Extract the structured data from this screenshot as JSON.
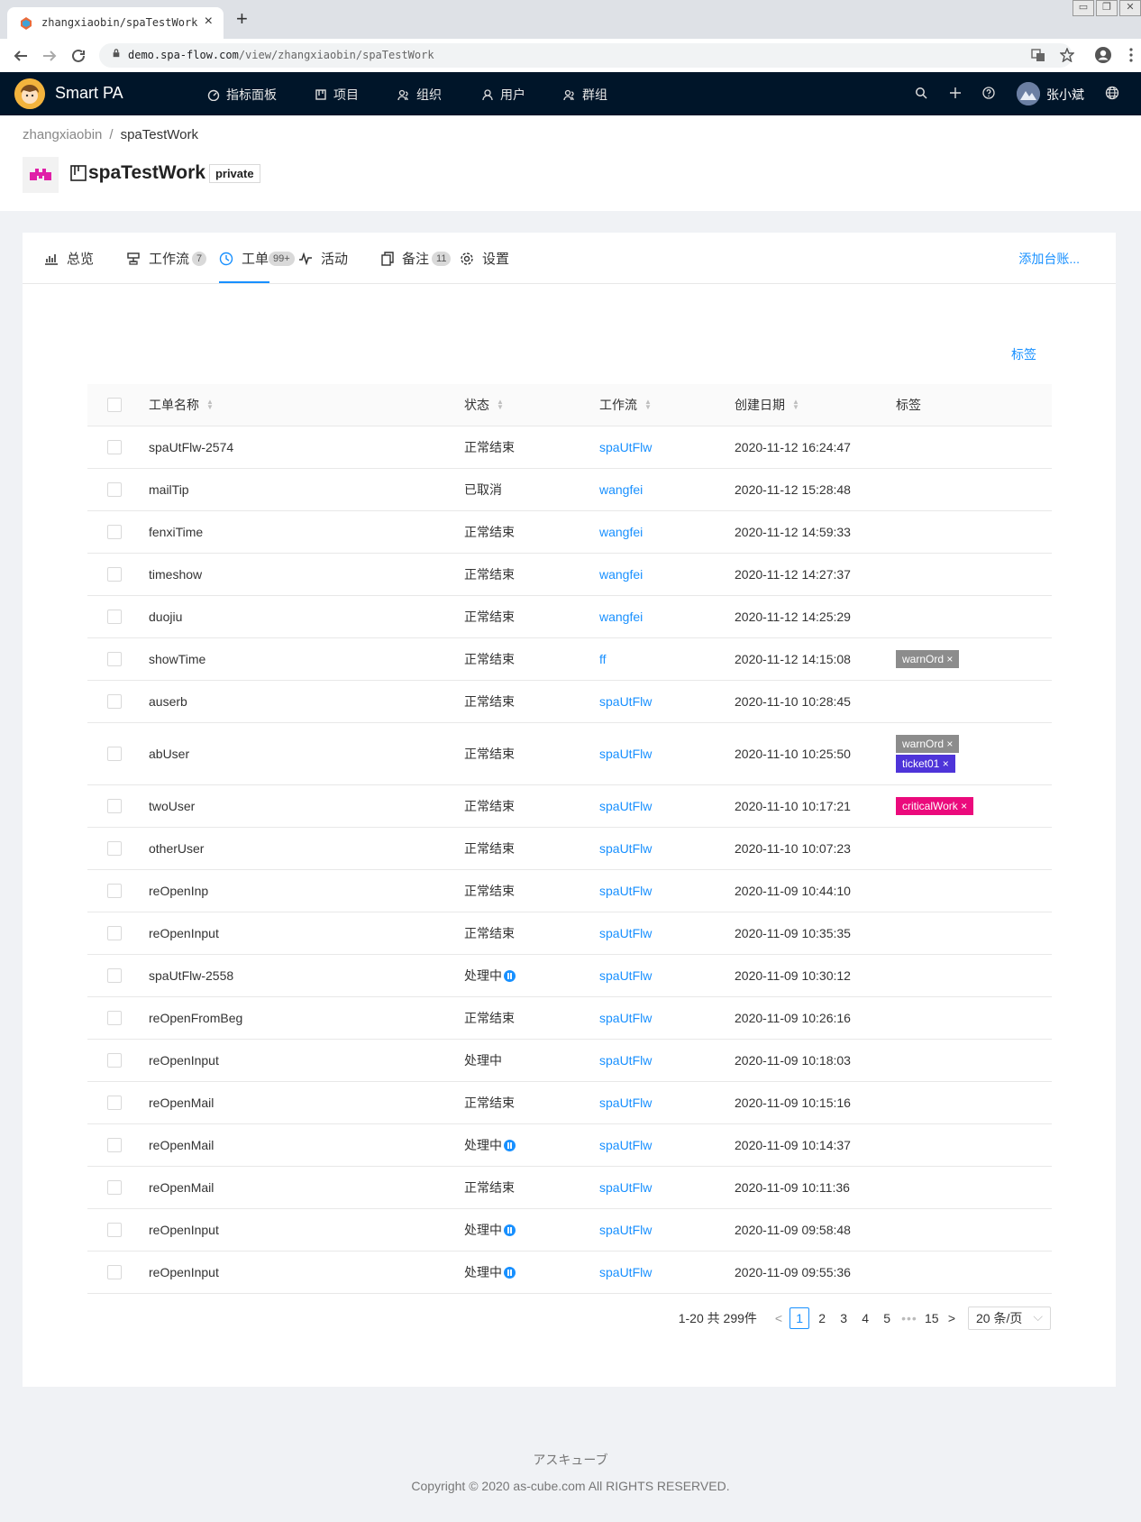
{
  "browser": {
    "tab_title": "zhangxiaobin/spaTestWork",
    "tab_close": "×",
    "new_tab": "+",
    "url_host": "demo.spa-flow.com",
    "url_path": "/view/zhangxiaobin/spaTestWork"
  },
  "header": {
    "brand": "Smart PA",
    "menu": [
      "指标面板",
      "项目",
      "组织",
      "用户",
      "群组"
    ],
    "user_name": "张小斌"
  },
  "breadcrumb": {
    "parent": "zhangxiaobin",
    "separator": "/",
    "current": "spaTestWork"
  },
  "project": {
    "title": "spaTestWork",
    "visibility": "private"
  },
  "tabs": [
    {
      "label": "总览",
      "badge": ""
    },
    {
      "label": "工作流",
      "badge": "7"
    },
    {
      "label": "工单",
      "badge": "99+"
    },
    {
      "label": "活动",
      "badge": ""
    },
    {
      "label": "备注",
      "badge": "11"
    },
    {
      "label": "设置",
      "badge": ""
    }
  ],
  "add_ledger": "添加台账...",
  "tag_link": "标签",
  "table": {
    "columns": [
      "工单名称",
      "状态",
      "工作流",
      "创建日期",
      "标签"
    ],
    "rows": [
      {
        "name": "spaUtFlw-2574",
        "status": "正常结束",
        "paused": false,
        "flow": "spaUtFlw",
        "date": "2020-11-12 16:24:47",
        "tags": []
      },
      {
        "name": "mailTip",
        "status": "已取消",
        "paused": false,
        "flow": "wangfei",
        "date": "2020-11-12 15:28:48",
        "tags": []
      },
      {
        "name": "fenxiTime",
        "status": "正常结束",
        "paused": false,
        "flow": "wangfei",
        "date": "2020-11-12 14:59:33",
        "tags": []
      },
      {
        "name": "timeshow",
        "status": "正常结束",
        "paused": false,
        "flow": "wangfei",
        "date": "2020-11-12 14:27:37",
        "tags": []
      },
      {
        "name": "duojiu",
        "status": "正常结束",
        "paused": false,
        "flow": "wangfei",
        "date": "2020-11-12 14:25:29",
        "tags": []
      },
      {
        "name": "showTime",
        "status": "正常结束",
        "paused": false,
        "flow": "ff",
        "date": "2020-11-12 14:15:08",
        "tags": [
          {
            "label": "warnOrd ×",
            "color": "#8c8c8c"
          }
        ]
      },
      {
        "name": "auserb",
        "status": "正常结束",
        "paused": false,
        "flow": "spaUtFlw",
        "date": "2020-11-10 10:28:45",
        "tags": []
      },
      {
        "name": "abUser",
        "status": "正常结束",
        "paused": false,
        "flow": "spaUtFlw",
        "date": "2020-11-10 10:25:50",
        "tags": [
          {
            "label": "warnOrd ×",
            "color": "#8c8c8c"
          },
          {
            "label": "ticket01 ×",
            "color": "#4e34d9"
          }
        ]
      },
      {
        "name": "twoUser",
        "status": "正常结束",
        "paused": false,
        "flow": "spaUtFlw",
        "date": "2020-11-10 10:17:21",
        "tags": [
          {
            "label": "criticalWork ×",
            "color": "#eb0a7c"
          }
        ]
      },
      {
        "name": "otherUser",
        "status": "正常结束",
        "paused": false,
        "flow": "spaUtFlw",
        "date": "2020-11-10 10:07:23",
        "tags": []
      },
      {
        "name": "reOpenInp",
        "status": "正常结束",
        "paused": false,
        "flow": "spaUtFlw",
        "date": "2020-11-09 10:44:10",
        "tags": []
      },
      {
        "name": "reOpenInput",
        "status": "正常结束",
        "paused": false,
        "flow": "spaUtFlw",
        "date": "2020-11-09 10:35:35",
        "tags": []
      },
      {
        "name": "spaUtFlw-2558",
        "status": "处理中",
        "paused": true,
        "flow": "spaUtFlw",
        "date": "2020-11-09 10:30:12",
        "tags": []
      },
      {
        "name": "reOpenFromBeg",
        "status": "正常结束",
        "paused": false,
        "flow": "spaUtFlw",
        "date": "2020-11-09 10:26:16",
        "tags": []
      },
      {
        "name": "reOpenInput",
        "status": "处理中",
        "paused": false,
        "flow": "spaUtFlw",
        "date": "2020-11-09 10:18:03",
        "tags": []
      },
      {
        "name": "reOpenMail",
        "status": "正常结束",
        "paused": false,
        "flow": "spaUtFlw",
        "date": "2020-11-09 10:15:16",
        "tags": []
      },
      {
        "name": "reOpenMail",
        "status": "处理中",
        "paused": true,
        "flow": "spaUtFlw",
        "date": "2020-11-09 10:14:37",
        "tags": []
      },
      {
        "name": "reOpenMail",
        "status": "正常结束",
        "paused": false,
        "flow": "spaUtFlw",
        "date": "2020-11-09 10:11:36",
        "tags": []
      },
      {
        "name": "reOpenInput",
        "status": "处理中",
        "paused": true,
        "flow": "spaUtFlw",
        "date": "2020-11-09 09:58:48",
        "tags": []
      },
      {
        "name": "reOpenInput",
        "status": "处理中",
        "paused": true,
        "flow": "spaUtFlw",
        "date": "2020-11-09 09:55:36",
        "tags": []
      }
    ]
  },
  "pagination": {
    "total_text": "1-20 共 299件",
    "pages": [
      "1",
      "2",
      "3",
      "4",
      "5"
    ],
    "current": "1",
    "ellipsis": "•••",
    "last": "15",
    "prev": "<",
    "next": ">",
    "page_size": "20 条/页"
  },
  "footer": {
    "company": "アスキューブ",
    "copyright": "Copyright © 2020 as-cube.com All RIGHTS RESERVED."
  }
}
